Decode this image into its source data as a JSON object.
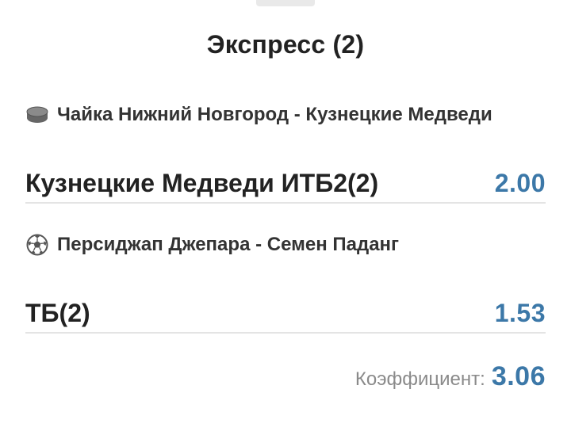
{
  "title": "Экспресс (2)",
  "events": [
    {
      "icon": "hockey-puck-icon",
      "name": "Чайка Нижний Новгород - Кузнецкие Медведи",
      "bet": "Кузнецкие Медведи ИТБ2(2)",
      "odds": "2.00"
    },
    {
      "icon": "soccer-ball-icon",
      "name": "Персиджап Джепара - Семен Паданг",
      "bet": "ТБ(2)",
      "odds": "1.53"
    }
  ],
  "total": {
    "label": "Коэффициент:",
    "value": "3.06"
  },
  "colors": {
    "odds": "#3c78a8",
    "label": "#8a8a8a",
    "divider": "#e4e4e4"
  }
}
